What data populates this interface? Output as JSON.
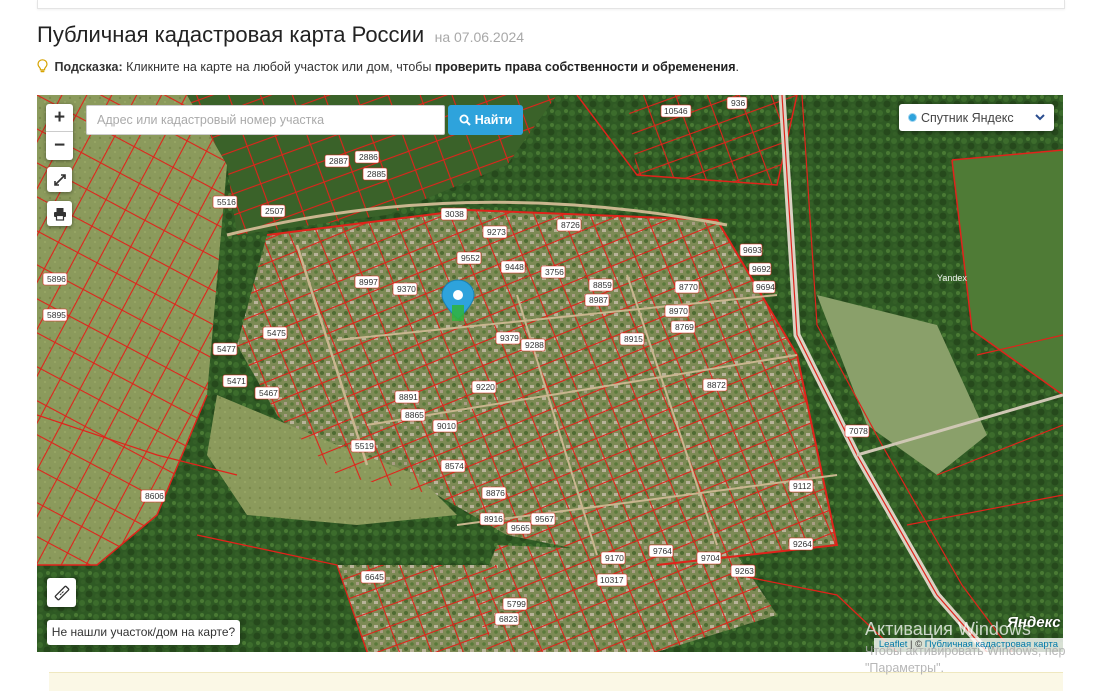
{
  "page": {
    "title": "Публичная кадастровая карта России",
    "date": "на 07.06.2024"
  },
  "hint": {
    "label": "Подсказка:",
    "text": " Кликните на карте на любой участок или дом, чтобы ",
    "link": "проверить права собственности и обременения",
    "end": "."
  },
  "map": {
    "zoom_in": "+",
    "zoom_out": "−",
    "search_placeholder": "Адрес или кадастровый номер участка",
    "search_button": "Найти",
    "layer": "Спутник Яндекс",
    "not_found": "Не нашли участок/дом на карте?",
    "yandex_logo": "Яндекс",
    "yandex_mark": "Yandex",
    "attribution_leaflet": "Leaflet",
    "attribution_sep": " | © ",
    "attribution_source": "Публичная кадастровая карта",
    "accent_color": "#2ea3dc",
    "parcel_color": "#e0231b",
    "plot_labels": [
      "2887",
      "2886",
      "2885",
      "3038",
      "8726",
      "9273",
      "9552",
      "9448",
      "3756",
      "8859",
      "8987",
      "8770",
      "8970",
      "9370",
      "8997",
      "9379",
      "9288",
      "8915",
      "8872",
      "8769",
      "9220",
      "9010",
      "8865",
      "8891",
      "8574",
      "8876",
      "8916",
      "9565",
      "9567",
      "9170",
      "9764",
      "9704",
      "9263",
      "9112",
      "9264",
      "7078",
      "9693",
      "9692",
      "9694",
      "5516",
      "2507",
      "8606",
      "5896",
      "5895",
      "5471",
      "5475",
      "5477",
      "5467",
      "5519",
      "6645",
      "5799",
      "6823",
      "936",
      "10546",
      "10317"
    ]
  },
  "watermark": {
    "title": "Активация Windows",
    "line1": "Чтобы активировать Windows, пер",
    "line2": "\"Параметры\"."
  }
}
